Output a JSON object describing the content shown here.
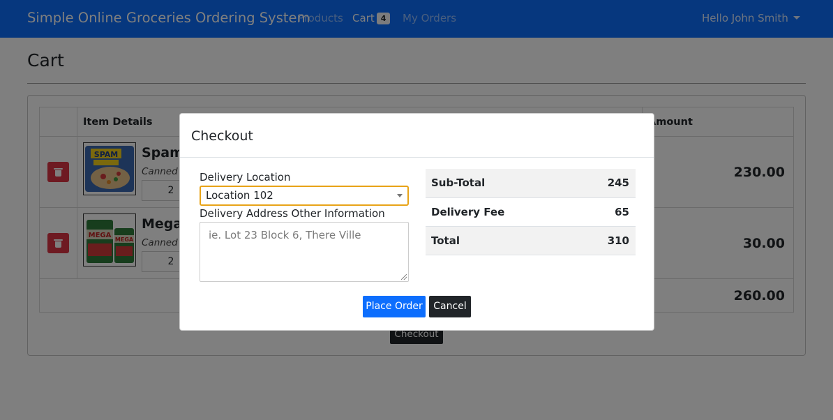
{
  "navbar": {
    "brand": "Simple Online Groceries Ordering System",
    "links": {
      "products": "Products",
      "cart": "Cart",
      "my_orders": "My Orders"
    },
    "cart_count": "4",
    "user_greeting": "Hello John Smith"
  },
  "page": {
    "title": "Cart"
  },
  "cart": {
    "headers": {
      "item_details": "Item Details",
      "amount": "Amount"
    },
    "items": [
      {
        "name": "Spam",
        "category": "Canned G",
        "quantity": "2",
        "amount": "230.00"
      },
      {
        "name": "Mega",
        "category": "Canned G",
        "quantity": "2",
        "amount": "30.00"
      }
    ],
    "grand_total": "260.00",
    "checkout_label": "Checkout"
  },
  "modal": {
    "title": "Checkout",
    "delivery_location_label": "Delivery Location",
    "delivery_location_value": "Location 102",
    "address_label": "Delivery Address Other Information",
    "address_placeholder": "ie. Lot 23 Block 6, There Ville",
    "summary": {
      "subtotal_label": "Sub-Total",
      "subtotal_value": "245",
      "delivery_fee_label": "Delivery Fee",
      "delivery_fee_value": "65",
      "total_label": "Total",
      "total_value": "310"
    },
    "place_order_label": "Place Order",
    "cancel_label": "Cancel"
  },
  "colors": {
    "primary": "#0d6efd",
    "danger": "#dc3545",
    "dark": "#212529",
    "focus_border": "#e8a317"
  },
  "icons": {
    "delete": "trash-icon",
    "dropdown": "caret-down-icon"
  }
}
